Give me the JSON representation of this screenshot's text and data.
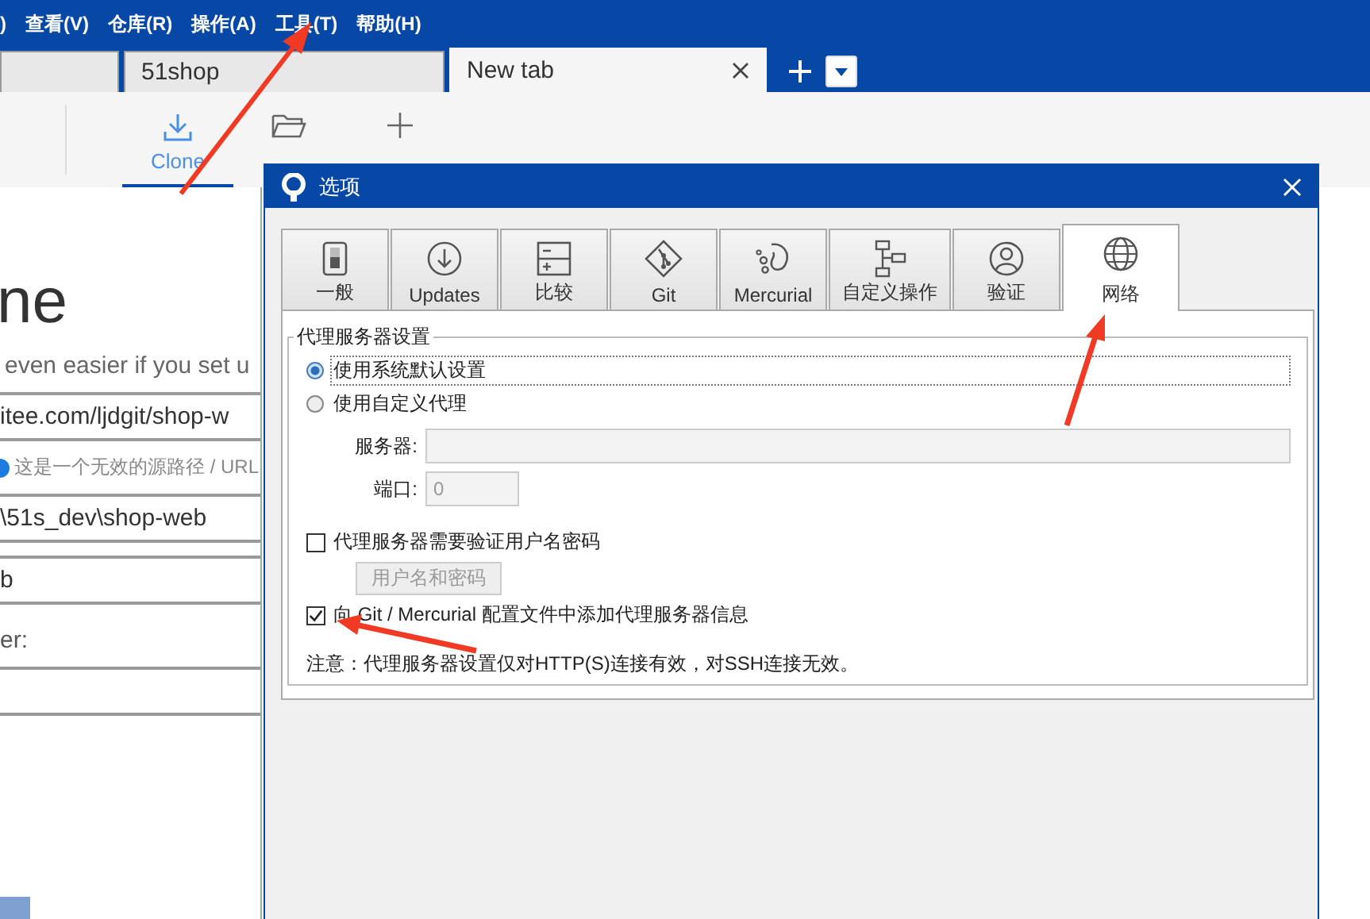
{
  "menu": [
    ")",
    "查看(V)",
    "仓库(R)",
    "操作(A)",
    "工具(T)",
    "帮助(H)"
  ],
  "tabs": [
    {
      "selected": false
    },
    {
      "label": "51shop",
      "selected": false
    },
    {
      "label": "New tab",
      "selected": true
    }
  ],
  "toolbar": [
    {
      "kind": "download",
      "label": "Clone",
      "selected": true
    },
    {
      "kind": "folder",
      "selected": false
    },
    {
      "kind": "plus",
      "selected": false
    }
  ],
  "clone_page": {
    "heading": "ne",
    "subtitle": "even easier if you set u",
    "rows": [
      {
        "kind": "input",
        "value": "itee.com/ljdgit/shop-w"
      },
      {
        "kind": "info",
        "text": "这是一个无效的源路径 / URL"
      },
      {
        "kind": "input",
        "value": "\\51s_dev\\shop-web"
      },
      {
        "kind": "input",
        "value": "b"
      },
      {
        "kind": "label",
        "text": "er:"
      },
      {
        "kind": "input",
        "value": ""
      }
    ]
  },
  "dialog": {
    "title": "选项",
    "tabs": [
      {
        "kind": "general",
        "label": "一般",
        "selected": false
      },
      {
        "kind": "updates",
        "label": "Updates",
        "selected": false
      },
      {
        "kind": "diff",
        "label": "比较",
        "selected": false
      },
      {
        "kind": "git",
        "label": "Git",
        "selected": false
      },
      {
        "kind": "mercurial",
        "label": "Mercurial",
        "selected": false
      },
      {
        "kind": "custom",
        "label": "自定义操作",
        "selected": false
      },
      {
        "kind": "auth",
        "label": "验证",
        "selected": false
      },
      {
        "kind": "network",
        "label": "网络",
        "selected": true
      }
    ],
    "group_title": "代理服务器设置",
    "radios": [
      {
        "label": "使用系统默认设置",
        "selected": true
      },
      {
        "label": "使用自定义代理",
        "selected": false
      }
    ],
    "server_label": "服务器:",
    "port_label": "端口:",
    "port_value": "0",
    "auth_checkbox": {
      "label": "代理服务器需要验证用户名密码",
      "checked": false
    },
    "credentials_button": {
      "label": "用户名和密码",
      "disabled": true
    },
    "config_checkbox": {
      "label": "向 Git / Mercurial 配置文件中添加代理服务器信息",
      "checked": true
    },
    "note": "注意：代理服务器设置仅对HTTP(S)连接有效，对SSH连接无效。"
  }
}
